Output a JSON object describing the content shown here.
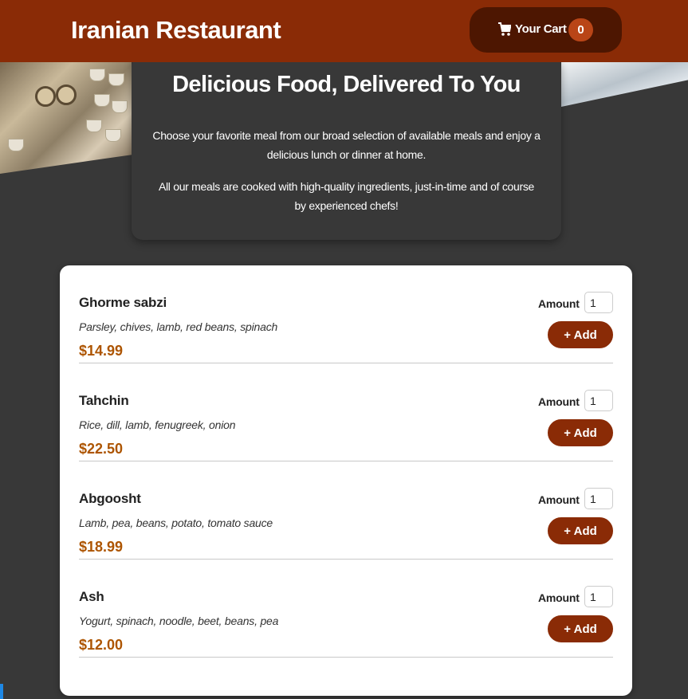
{
  "header": {
    "brand": "Iranian Restaurant",
    "cart": {
      "label": "Your Cart",
      "count": "0",
      "icon": "cart-icon"
    }
  },
  "hero": {
    "title": "Delicious Food, Delivered To You",
    "paragraph1": "Choose your favorite meal from our broad selection of available meals and enjoy a delicious lunch or dinner at home.",
    "paragraph2": "All our meals are cooked with high-quality ingredients, just-in-time and of course by experienced chefs!"
  },
  "colors": {
    "header_bg": "#8a2b06",
    "cart_bg": "#4d1601",
    "badge_bg": "#b94517",
    "price": "#ad5502",
    "page_bg": "#383838"
  },
  "meals": [
    {
      "name": "Ghorme sabzi",
      "description": "Parsley, chives, lamb, red beans, spinach",
      "price": "$14.99",
      "amount_label": "Amount",
      "amount_value": "1",
      "add_label": "+ Add"
    },
    {
      "name": "Tahchin",
      "description": "Rice, dill, lamb, fenugreek, onion",
      "price": "$22.50",
      "amount_label": "Amount",
      "amount_value": "1",
      "add_label": "+ Add"
    },
    {
      "name": "Abgoosht",
      "description": "Lamb, pea, beans, potato, tomato sauce",
      "price": "$18.99",
      "amount_label": "Amount",
      "amount_value": "1",
      "add_label": "+ Add"
    },
    {
      "name": "Ash",
      "description": "Yogurt, spinach, noodle, beet, beans, pea",
      "price": "$12.00",
      "amount_label": "Amount",
      "amount_value": "1",
      "add_label": "+ Add"
    }
  ]
}
